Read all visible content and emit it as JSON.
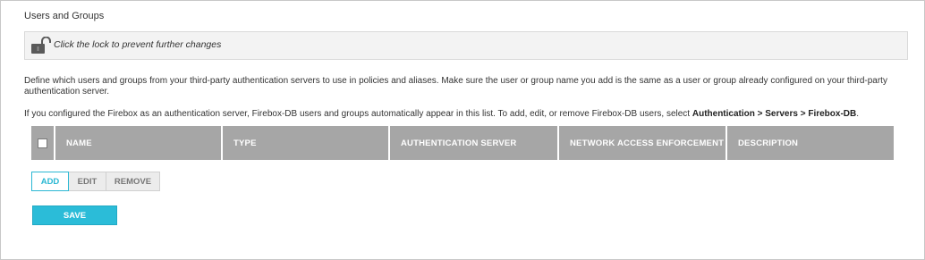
{
  "page": {
    "title": "Users and Groups"
  },
  "lock_bar": {
    "icon": "unlocked-padlock-icon",
    "text": "Click the lock to prevent further changes"
  },
  "description": {
    "paragraph1": "Define which users and groups from your third-party authentication servers to use in policies and aliases. Make sure the user or group name you add is the same as a user or group already configured on your third-party authentication server.",
    "paragraph2_prefix": "If you configured the Firebox as an authentication server, Firebox-DB users and groups automatically appear in this list. To add, edit, or remove Firebox-DB users, select ",
    "paragraph2_bold": "Authentication > Servers > Firebox-DB",
    "paragraph2_suffix": "."
  },
  "table": {
    "columns": {
      "name": "NAME",
      "type": "TYPE",
      "auth_server": "AUTHENTICATION SERVER",
      "nae": "NETWORK ACCESS ENFORCEMENT",
      "description": "DESCRIPTION"
    },
    "rows": []
  },
  "actions": {
    "add": "ADD",
    "edit": "EDIT",
    "remove": "REMOVE",
    "save": "SAVE"
  },
  "colors": {
    "accent": "#2bbcd8",
    "table_header": "#a6a6a6",
    "lock_bar_bg": "#f3f3f3"
  }
}
